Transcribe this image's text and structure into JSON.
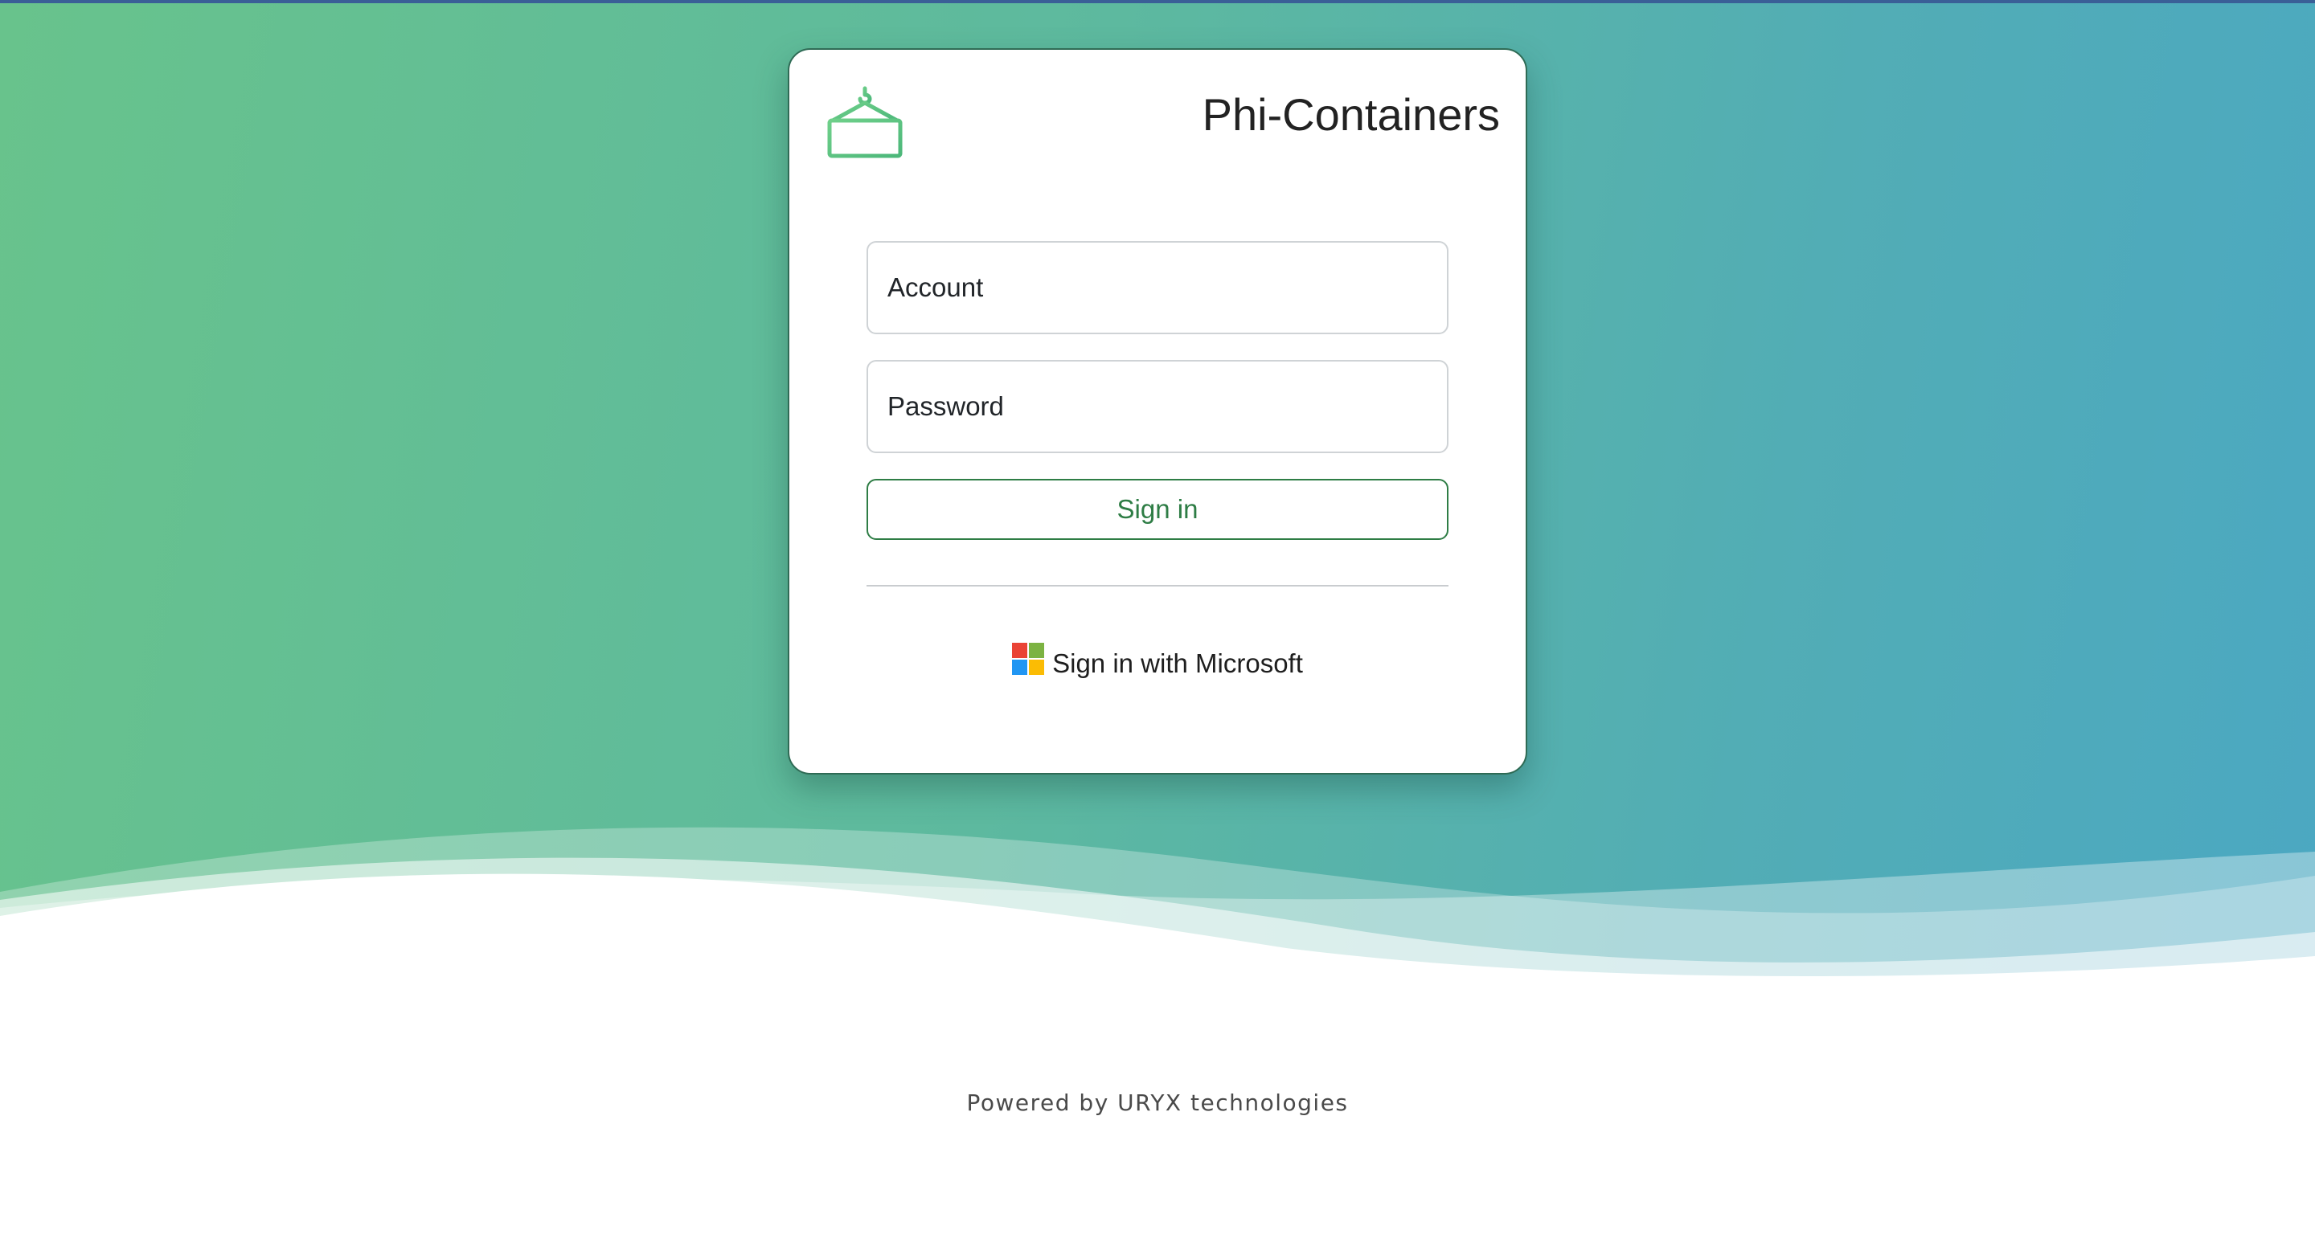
{
  "app": {
    "title": "Phi-Containers"
  },
  "login": {
    "account_placeholder": "Account",
    "password_placeholder": "Password",
    "signin_label": "Sign in",
    "microsoft_label": "Sign in with Microsoft"
  },
  "icons": {
    "logo": "shipping-container-icon",
    "microsoft": "microsoft-logo-icon"
  },
  "footer": {
    "text": "Powered by URYX technologies"
  },
  "colors": {
    "gradient_start": "#68c38c",
    "gradient_end": "#4ba8c2",
    "accent_green": "#2e7d45",
    "ms_red": "#f25022",
    "ms_green": "#7fba00",
    "ms_blue": "#00a4ef",
    "ms_yellow": "#ffb900"
  }
}
